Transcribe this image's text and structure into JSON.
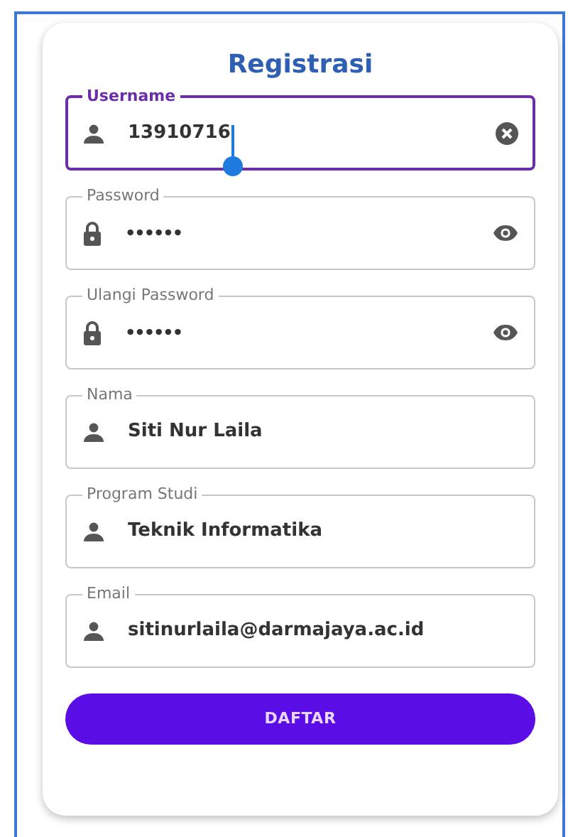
{
  "title": "Registrasi",
  "fields": [
    {
      "label": "Username",
      "value": "13910716",
      "kind": "text",
      "focused": true
    },
    {
      "label": "Password",
      "value": "••••••",
      "kind": "password",
      "focused": false
    },
    {
      "label": "Ulangi Password",
      "value": "••••••",
      "kind": "password",
      "focused": false
    },
    {
      "label": "Nama",
      "value": "Siti Nur Laila",
      "kind": "text",
      "focused": false
    },
    {
      "label": "Program Studi",
      "value": "Teknik Informatika",
      "kind": "text",
      "focused": false
    },
    {
      "label": "Email",
      "value": "sitinurlaila@darmajaya.ac.id",
      "kind": "text",
      "focused": false
    }
  ],
  "button": "DAFTAR"
}
